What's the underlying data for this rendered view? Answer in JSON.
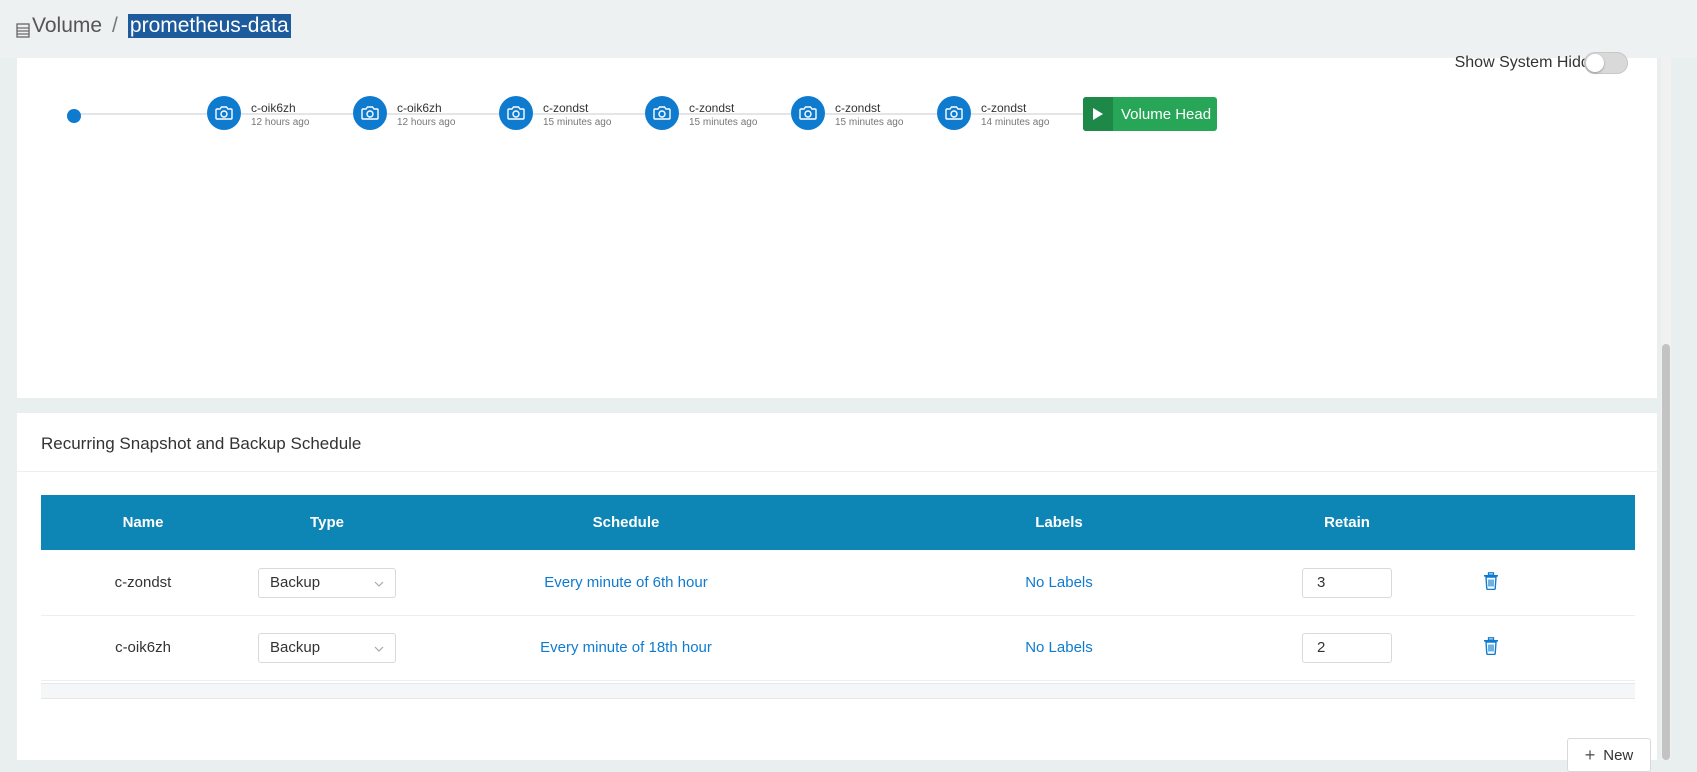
{
  "breadcrumb": {
    "section": "Volume",
    "separator": "/",
    "current": "prometheus-data"
  },
  "snapshots_panel": {
    "show_system_hidden_label": "Show System Hidden:",
    "show_system_hidden_on": false,
    "snapshots": [
      {
        "name": "c-oik6zh",
        "time": "12 hours ago"
      },
      {
        "name": "c-oik6zh",
        "time": "12 hours ago"
      },
      {
        "name": "c-zondst",
        "time": "15 minutes ago"
      },
      {
        "name": "c-zondst",
        "time": "15 minutes ago"
      },
      {
        "name": "c-zondst",
        "time": "15 minutes ago"
      },
      {
        "name": "c-zondst",
        "time": "14 minutes ago"
      }
    ],
    "volume_head_label": "Volume Head"
  },
  "schedule": {
    "title": "Recurring Snapshot and Backup Schedule",
    "columns": {
      "name": "Name",
      "type": "Type",
      "schedule": "Schedule",
      "labels": "Labels",
      "retain": "Retain"
    },
    "rows": [
      {
        "name": "c-zondst",
        "type": "Backup",
        "schedule": "Every minute of 6th hour",
        "labels": "No Labels",
        "retain": "3"
      },
      {
        "name": "c-oik6zh",
        "type": "Backup",
        "schedule": "Every minute of 18th hour",
        "labels": "No Labels",
        "retain": "2"
      }
    ],
    "new_button_label": "New"
  },
  "colors": {
    "primary": "#0f7bcf",
    "table_header": "#0d85b5",
    "volume_head": "#27a657",
    "breadcrumb_highlight": "#1d5b9c"
  },
  "icons": {
    "breadcrumb": "volume-list-icon",
    "snapshot": "camera-icon",
    "volume_head": "play-icon",
    "delete": "trash-icon",
    "add": "plus-icon",
    "select": "chevron-down-icon"
  }
}
